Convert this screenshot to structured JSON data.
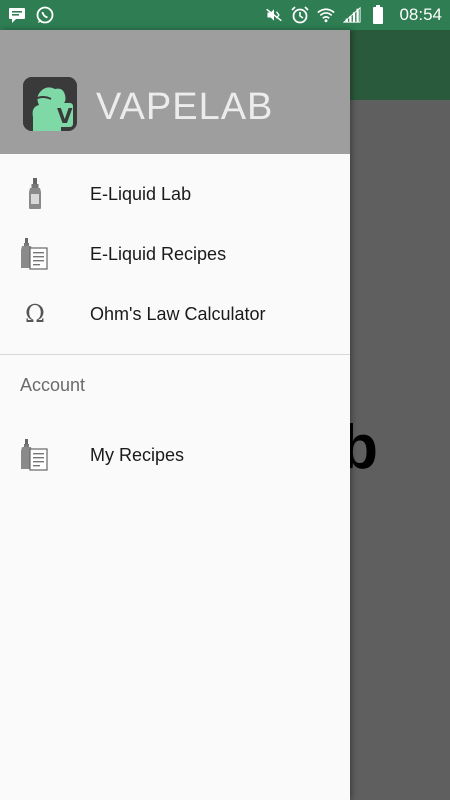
{
  "status_bar": {
    "time": "08:54",
    "left_icons": [
      "message-icon",
      "whatsapp-icon"
    ],
    "right_icons": [
      "mute-icon",
      "alarm-icon",
      "wifi-icon",
      "signal-icon",
      "battery-icon"
    ]
  },
  "background_app": {
    "visible_title_fragment": "b"
  },
  "drawer": {
    "app_name": "VAPELAB",
    "logo_letter": "V",
    "menu": [
      {
        "label": "E-Liquid Lab",
        "icon": "bottle-icon"
      },
      {
        "label": "E-Liquid Recipes",
        "icon": "bottle-recipe-icon"
      },
      {
        "label": "Ohm's Law Calculator",
        "icon": "omega-icon",
        "glyph": "Ω"
      }
    ],
    "section_title": "Account",
    "account_menu": [
      {
        "label": "My Recipes",
        "icon": "bottle-recipe-icon"
      }
    ]
  },
  "colors": {
    "status_bar": "#2e7d53",
    "toolbar": "#2a5a3c",
    "header": "#9e9e9e",
    "logo_accent": "#7ed9a6"
  }
}
